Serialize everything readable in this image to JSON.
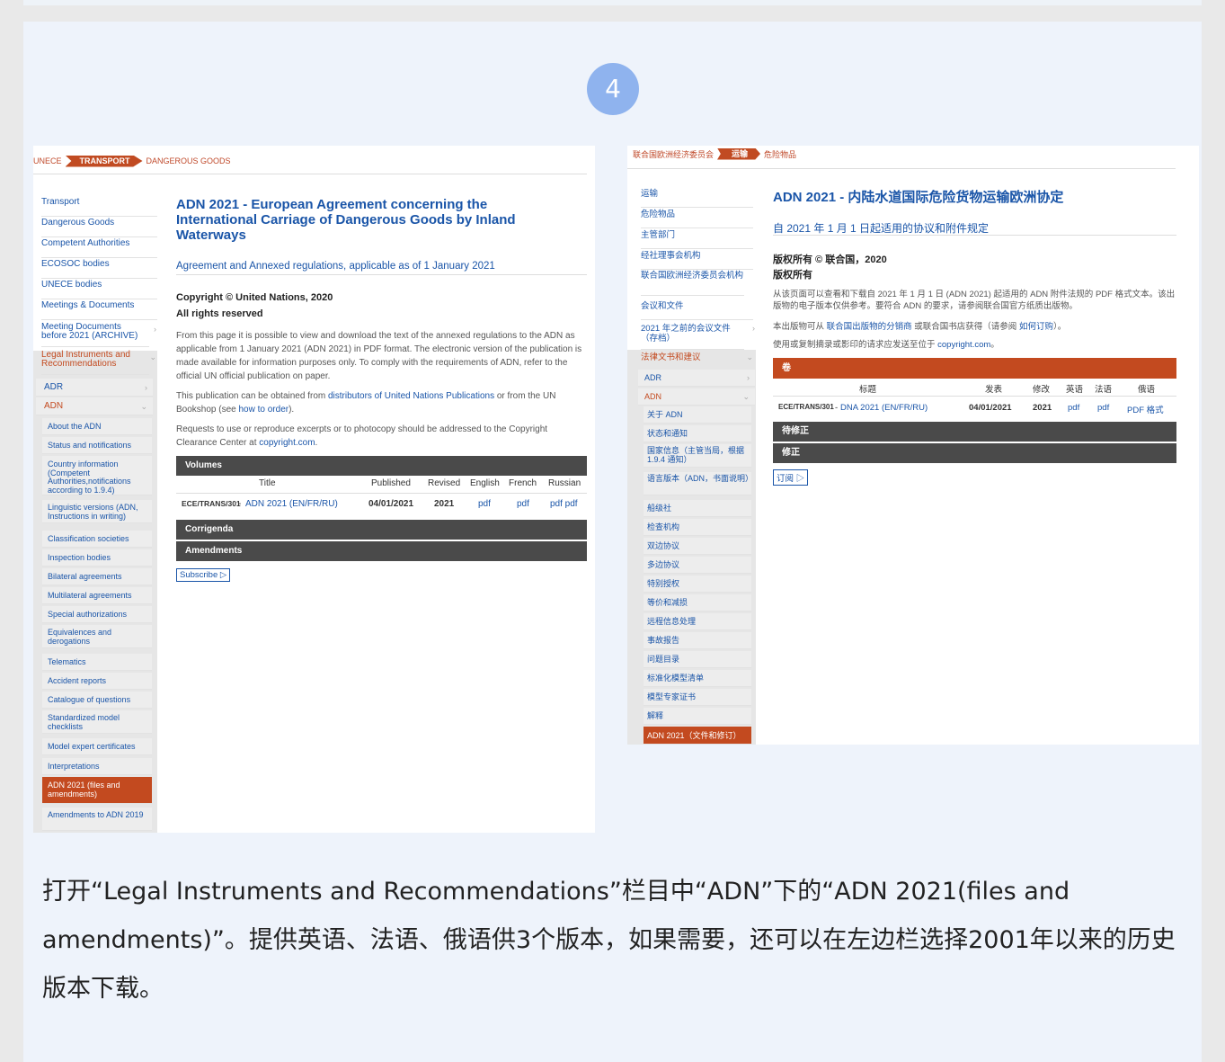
{
  "step_number": "4",
  "en": {
    "breadcrumb": [
      "UNECE",
      "TRANSPORT",
      "DANGEROUS GOODS"
    ],
    "nav": [
      "Transport",
      "Dangerous Goods",
      "Competent Authorities",
      "ECOSOC bodies",
      "UNECE bodies",
      "Meetings & Documents",
      "Meeting Documents before 2021 (ARCHIVE)",
      "Legal Instruments and Recommendations",
      "ADR",
      "ADN",
      "About the ADN",
      "Status and notifications",
      "Country information (Competent Authorities,notifications according to 1.9.4)",
      "Linguistic versions (ADN, Instructions in writing)",
      "Classification societies",
      "Inspection bodies",
      "Bilateral agreements",
      "Multilateral agreements",
      "Special authorizations",
      "Equivalences and derogations",
      "Telematics",
      "Accident reports",
      "Catalogue of questions",
      "Standardized model checklists",
      "Model expert certificates",
      "Interpretations",
      "ADN 2021 (files and amendments)",
      "Amendments to ADN 2019"
    ],
    "title": "ADN 2021 - European Agreement concerning the International Carriage of Dangerous Goods by Inland Waterways",
    "subtitle": "Agreement and Annexed regulations, applicable as of 1 January 2021",
    "copyright": "Copyright © United Nations, 2020",
    "rights": "All rights reserved",
    "para1": "From this page it is possible to view and download the text of the annexed regulations to the ADN as applicable from 1 January 2021 (ADN 2021) in PDF format. The electronic version of the publication is made available for information purposes only. To comply with the requirements of ADN, refer to the official UN official publication on paper.",
    "para2_a": "This publication can be obtained from ",
    "para2_link": "distributors of United Nations Publications",
    "para2_b": " or from the UN Bookshop (see ",
    "para2_link2": "how to order",
    "para2_c": ").",
    "para3_a": "Requests to use or reproduce excerpts or to photocopy should be addressed to the Copyright Clearance Center at ",
    "para3_link": "copyright.com",
    "para3_b": ".",
    "volumes": "Volumes",
    "headers": [
      "Title",
      "Published",
      "Revised",
      "English",
      "French",
      "Russian"
    ],
    "row": {
      "code": "ECE/TRANS/301",
      "title": "ADN 2021 (EN/FR/RU)",
      "published": "04/01/2021",
      "revised": "2021",
      "english": "pdf",
      "french": "pdf",
      "russian": "pdf pdf"
    },
    "corrigenda": "Corrigenda",
    "amendments": "Amendments",
    "subscribe": "Subscribe ▷"
  },
  "zh": {
    "breadcrumb": [
      "联合国欧洲经济委员会",
      "运输",
      "危险物品"
    ],
    "nav": [
      "运输",
      "危险物品",
      "主管部门",
      "经社理事会机构",
      "联合国欧洲经济委员会机构",
      "会议和文件",
      "2021 年之前的会议文件（存档）",
      "法律文书和建议",
      "ADR",
      "ADN",
      "关于 ADN",
      "状态和通知",
      "国家信息（主管当局，根据 1.9.4 通知）",
      "语言版本（ADN，书面说明）",
      "船级社",
      "检查机构",
      "双边协议",
      "多边协议",
      "特别授权",
      "等价和减损",
      "远程信息处理",
      "事故报告",
      "问题目录",
      "标准化模型清单",
      "模型专家证书",
      "解释",
      "ADN 2021（文件和修订）"
    ],
    "title": "ADN 2021 - 内陆水道国际危险货物运输欧洲协定",
    "subtitle": "自 2021 年 1 月 1 日起适用的协议和附件规定",
    "copyright": "版权所有 © 联合国，2020",
    "rights": "版权所有",
    "para1": "从该页面可以查看和下载自 2021 年 1 月 1 日 (ADN 2021) 起适用的 ADN 附件法规的 PDF 格式文本。该出版物的电子版本仅供参考。要符合 ADN 的要求，请参阅联合国官方纸质出版物。",
    "para2_a": "本出版物可从 ",
    "para2_link": "联合国出版物的分销商",
    "para2_b": " 或联合国书店获得（请参阅 ",
    "para2_link2": "如何订购",
    "para2_c": "）。",
    "para3_a": "使用或复制摘录或影印的请求应发送至位于 ",
    "para3_link": "copyright.com",
    "para3_b": "。",
    "volumes": "卷",
    "headers": [
      "标题",
      "发表",
      "修改",
      "英语",
      "法语",
      "俄语"
    ],
    "row": {
      "code": "ECE/TRANS/301",
      "title": "DNA 2021 (EN/FR/RU)",
      "published": "04/01/2021",
      "revised": "2021",
      "english": "pdf",
      "french": "pdf",
      "russian": "PDF 格式"
    },
    "corrigenda": "待修正",
    "amendments": "修正",
    "subscribe": "订阅 ▷"
  },
  "caption": "打开“Legal Instruments and Recommendations”栏目中“ADN”下的“ADN 2021(files and amendments)”。提供英语、法语、俄语供3个版本，如果需要，还可以在左边栏选择2001年以来的历史版本下载。"
}
